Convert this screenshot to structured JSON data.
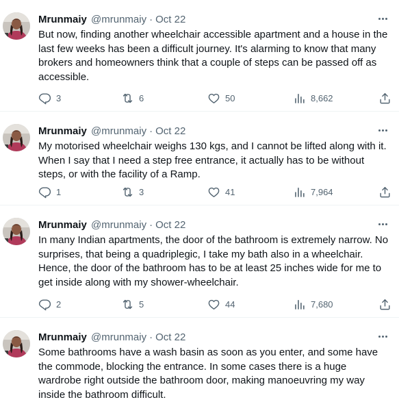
{
  "tweets": [
    {
      "author": {
        "name": "Mrunmaiy",
        "handle": "@mrunmaiy",
        "date": "Oct 22"
      },
      "separator": "·",
      "text": "But now, finding another wheelchair accessible apartment and a house in the last few weeks has been a difficult journey. It's alarming to know that many brokers and homeowners think that a couple of steps can be passed off as accessible.",
      "stats": {
        "replies": "3",
        "retweets": "6",
        "likes": "50",
        "views": "8,662"
      }
    },
    {
      "author": {
        "name": "Mrunmaiy",
        "handle": "@mrunmaiy",
        "date": "Oct 22"
      },
      "separator": "·",
      "text": "My motorised wheelchair weighs 130 kgs, and I cannot be lifted along with it. When I say that I need a step free entrance, it actually has to be without steps, or with the facility of a Ramp.",
      "stats": {
        "replies": "1",
        "retweets": "3",
        "likes": "41",
        "views": "7,964"
      }
    },
    {
      "author": {
        "name": "Mrunmaiy",
        "handle": "@mrunmaiy",
        "date": "Oct 22"
      },
      "separator": "·",
      "text": "In many Indian apartments, the door of the bathroom is extremely narrow. No surprises, that being a quadriplegic, I take my bath also in a wheelchair. Hence, the door of the bathroom has to be at least 25 inches wide for me to get inside along with my shower-wheelchair.",
      "stats": {
        "replies": "2",
        "retweets": "5",
        "likes": "44",
        "views": "7,680"
      }
    },
    {
      "author": {
        "name": "Mrunmaiy",
        "handle": "@mrunmaiy",
        "date": "Oct 22"
      },
      "separator": "·",
      "text": "Some bathrooms have a wash basin as soon as you enter, and some have the commode, blocking the entrance. In some cases there is a huge wardrobe right outside the bathroom door, making manoeuvring my way inside the bathroom difficult."
    }
  ],
  "icons": {
    "avatar": "profile-photo",
    "more": "more-icon",
    "reply": "reply-icon",
    "retweet": "retweet-icon",
    "like": "heart-icon",
    "views": "views-icon",
    "share": "share-icon"
  },
  "colors": {
    "text": "#0f1419",
    "secondary": "#536471",
    "divider": "#eff3f4"
  }
}
